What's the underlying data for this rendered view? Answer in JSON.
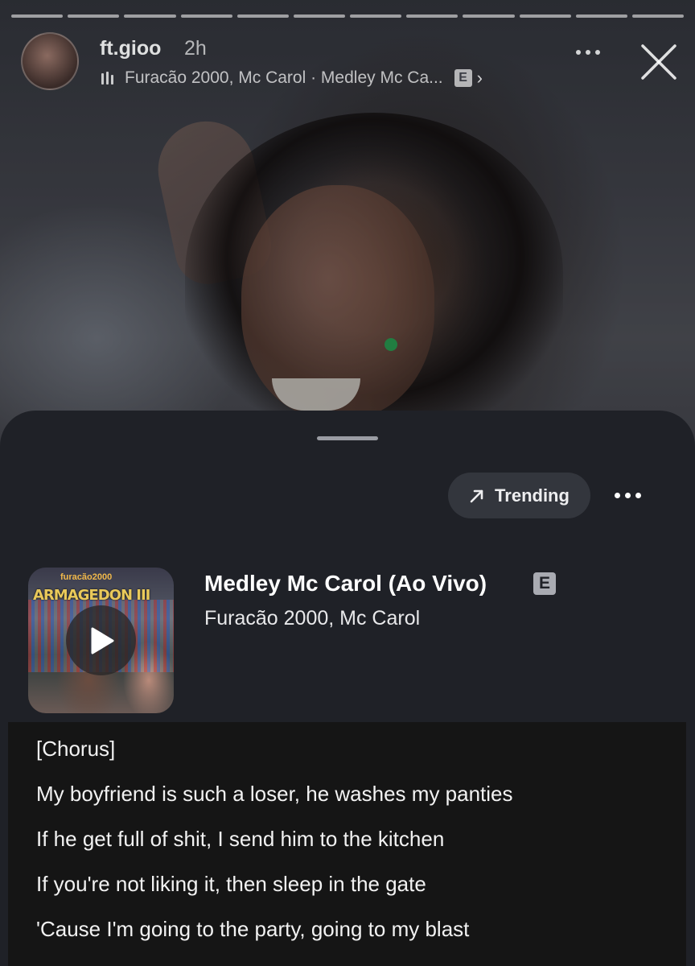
{
  "story": {
    "username": "ft.gioo",
    "time_ago": "2h",
    "music_label": "Furacão 2000, Mc Carol · Medley Mc Ca...",
    "explicit_badge": "E",
    "progress_segments": 12
  },
  "sheet": {
    "trending_label": "Trending",
    "song": {
      "title": "Medley Mc Carol (Ao Vivo)",
      "artist": "Furacão 2000, Mc Carol",
      "explicit_badge": "E"
    },
    "album_art": {
      "brand_text": "furacão2000",
      "title_text": "ARMAGEDON III"
    }
  },
  "lyrics": {
    "lines": [
      "[Chorus]",
      "My boyfriend is such a loser, he washes my panties",
      "If he get full of shit, I send him to the kitchen",
      "If you're not liking it, then sleep in the gate",
      "'Cause I'm going to the party, going to my blast"
    ]
  },
  "colors": {
    "sheet_bg": "#1f2127",
    "pill_bg": "#33363d",
    "lyrics_bg": "#151515"
  }
}
